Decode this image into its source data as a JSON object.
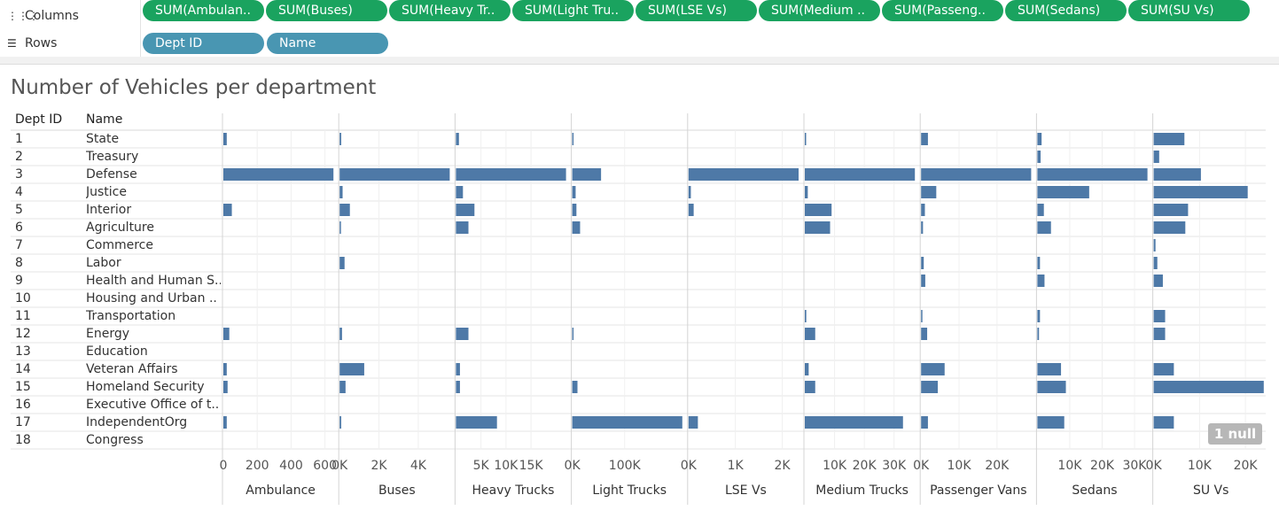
{
  "shelves": {
    "columns_label": "Columns",
    "rows_label": "Rows",
    "columns_pills": [
      "SUM(Ambulan..",
      "SUM(Buses)",
      "SUM(Heavy Tr..",
      "SUM(Light Tru..",
      "SUM(LSE Vs)",
      "SUM(Medium ..",
      "SUM(Passeng..",
      "SUM(Sedans)",
      "SUM(SU Vs)"
    ],
    "rows_pills": [
      "Dept ID",
      "Name"
    ]
  },
  "colors": {
    "bar": "#4e79a7",
    "pill_columns": "#1aa35f",
    "pill_rows": "#4996b2"
  },
  "null_indicator": "1 null",
  "chart_data": {
    "type": "bar",
    "title": "Number of Vehicles per department",
    "row_headers": [
      "Dept ID",
      "Name"
    ],
    "rows": [
      {
        "id": "1",
        "name": "State"
      },
      {
        "id": "2",
        "name": "Treasury"
      },
      {
        "id": "3",
        "name": "Defense"
      },
      {
        "id": "4",
        "name": "Justice"
      },
      {
        "id": "5",
        "name": "Interior"
      },
      {
        "id": "6",
        "name": "Agriculture"
      },
      {
        "id": "7",
        "name": "Commerce"
      },
      {
        "id": "8",
        "name": "Labor"
      },
      {
        "id": "9",
        "name": "Health and Human S.."
      },
      {
        "id": "10",
        "name": "Housing and Urban .."
      },
      {
        "id": "11",
        "name": "Transportation"
      },
      {
        "id": "12",
        "name": "Energy"
      },
      {
        "id": "13",
        "name": "Education"
      },
      {
        "id": "14",
        "name": "Veteran Affairs"
      },
      {
        "id": "15",
        "name": "Homeland Security"
      },
      {
        "id": "16",
        "name": "Executive Office of t.."
      },
      {
        "id": "17",
        "name": "IndependentOrg"
      },
      {
        "id": "18",
        "name": "Congress"
      }
    ],
    "series": [
      {
        "name": "Ambulance",
        "max": 650,
        "ticks": [
          {
            "v": 0,
            "t": "0"
          },
          {
            "v": 200,
            "t": "200"
          },
          {
            "v": 400,
            "t": "400"
          },
          {
            "v": 600,
            "t": "600"
          }
        ],
        "values": [
          20,
          null,
          650,
          null,
          50,
          null,
          null,
          null,
          null,
          null,
          null,
          35,
          null,
          20,
          25,
          null,
          20,
          null
        ]
      },
      {
        "name": "Buses",
        "max": 5600,
        "ticks": [
          {
            "v": 0,
            "t": "0K"
          },
          {
            "v": 2000,
            "t": "2K"
          },
          {
            "v": 4000,
            "t": "4K"
          }
        ],
        "values": [
          80,
          null,
          5600,
          150,
          520,
          50,
          null,
          250,
          null,
          null,
          null,
          120,
          null,
          1250,
          300,
          null,
          80,
          null
        ]
      },
      {
        "name": "Heavy Trucks",
        "max": 22000,
        "ticks": [
          {
            "v": 5000,
            "t": "5K"
          },
          {
            "v": 10000,
            "t": "10K"
          },
          {
            "v": 15000,
            "t": "15K"
          }
        ],
        "values": [
          600,
          null,
          22000,
          1400,
          3700,
          2500,
          null,
          null,
          null,
          null,
          null,
          2500,
          null,
          800,
          800,
          null,
          8200,
          null
        ]
      },
      {
        "name": "Light Trucks",
        "max": 210000,
        "ticks": [
          {
            "v": 0,
            "t": "0K"
          },
          {
            "v": 100000,
            "t": "100K"
          }
        ],
        "values": [
          1500,
          null,
          55000,
          6500,
          8000,
          15000,
          null,
          null,
          null,
          null,
          null,
          2000,
          null,
          null,
          10000,
          null,
          210000,
          null
        ]
      },
      {
        "name": "LSE Vs",
        "max": 2350,
        "ticks": [
          {
            "v": 0,
            "t": "0K"
          },
          {
            "v": 1000,
            "t": "1K"
          },
          {
            "v": 2000,
            "t": "2K"
          }
        ],
        "values": [
          null,
          null,
          2350,
          50,
          110,
          null,
          null,
          null,
          null,
          null,
          null,
          null,
          null,
          null,
          null,
          null,
          200,
          null
        ]
      },
      {
        "name": "Medium Trucks",
        "max": 37000,
        "ticks": [
          {
            "v": 10000,
            "t": "10K"
          },
          {
            "v": 20000,
            "t": "20K"
          },
          {
            "v": 30000,
            "t": "30K"
          }
        ],
        "values": [
          300,
          null,
          37000,
          1000,
          9000,
          8500,
          null,
          null,
          null,
          null,
          500,
          3500,
          null,
          1300,
          3500,
          null,
          33000,
          null
        ]
      },
      {
        "name": "Passenger Vans",
        "max": 29000,
        "ticks": [
          {
            "v": 0,
            "t": "0K"
          },
          {
            "v": 10000,
            "t": "10K"
          },
          {
            "v": 20000,
            "t": "20K"
          }
        ],
        "values": [
          1800,
          null,
          29000,
          4000,
          1000,
          500,
          null,
          700,
          1100,
          null,
          200,
          1600,
          null,
          6200,
          4400,
          null,
          1800,
          null
        ]
      },
      {
        "name": "Sedans",
        "max": 34000,
        "ticks": [
          {
            "v": 10000,
            "t": "10K"
          },
          {
            "v": 20000,
            "t": "20K"
          },
          {
            "v": 30000,
            "t": "30K"
          }
        ],
        "values": [
          1300,
          1000,
          34000,
          16000,
          2000,
          4200,
          null,
          800,
          2200,
          null,
          800,
          500,
          null,
          7300,
          8800,
          null,
          8300,
          null
        ]
      },
      {
        "name": "SU Vs",
        "max": 24000,
        "ticks": [
          {
            "v": 0,
            "t": "0K"
          },
          {
            "v": 10000,
            "t": "10K"
          },
          {
            "v": 20000,
            "t": "20K"
          }
        ],
        "values": [
          6700,
          1200,
          10300,
          20500,
          7500,
          6900,
          400,
          800,
          2000,
          null,
          2500,
          2500,
          null,
          4400,
          24000,
          null,
          4400,
          null
        ]
      }
    ]
  }
}
